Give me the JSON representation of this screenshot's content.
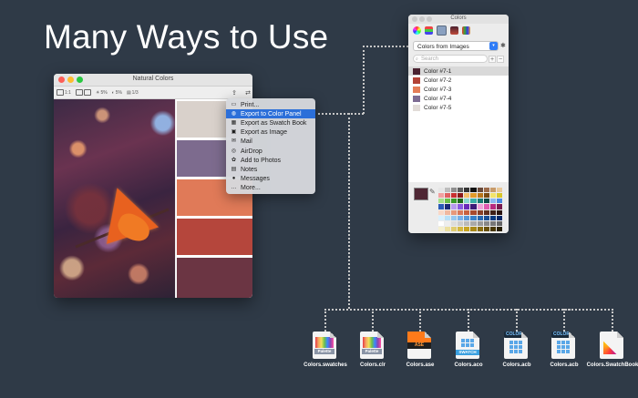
{
  "hero": {
    "title": "Many Ways to Use"
  },
  "window": {
    "title": "Natural Colors",
    "toolbar": [
      "1:1",
      "5%",
      "5%",
      "1/3"
    ],
    "swatch_colors": [
      "#d9d1cb",
      "#7d6b8e",
      "#e07a58",
      "#b5463c",
      "#6b3543"
    ]
  },
  "menu": {
    "items": [
      {
        "label": "Print...",
        "icon": "print-icon"
      },
      {
        "label": "Export to Color Panel",
        "icon": "color-wheel-icon",
        "active": true
      },
      {
        "label": "Export as Swatch Book",
        "icon": "swatch-book-icon"
      },
      {
        "label": "Export as Image",
        "icon": "image-icon"
      },
      {
        "label": "Mail",
        "icon": "mail-icon"
      },
      {
        "label": "AirDrop",
        "icon": "airdrop-icon"
      },
      {
        "label": "Add to Photos",
        "icon": "photos-icon"
      },
      {
        "label": "Notes",
        "icon": "notes-icon"
      },
      {
        "label": "Messages",
        "icon": "messages-icon"
      },
      {
        "label": "More...",
        "icon": "more-icon"
      }
    ]
  },
  "panel": {
    "title": "Colors",
    "select_value": "Colors from Images",
    "search_placeholder": "Search",
    "add_label": "+",
    "remove_label": "−",
    "colors": [
      {
        "name": "Color #7-1",
        "hex": "#4a2230"
      },
      {
        "name": "Color #7-2",
        "hex": "#b34236"
      },
      {
        "name": "Color #7-3",
        "hex": "#e47d58"
      },
      {
        "name": "Color #7-4",
        "hex": "#7e6c93"
      },
      {
        "name": "Color #7-5",
        "hex": "#e2dcd8"
      }
    ],
    "current_color": "#4e2633"
  },
  "files": [
    {
      "label": "Colors.swatches",
      "badge": "Palette",
      "kind": "palette"
    },
    {
      "label": "Colors.clr",
      "badge": "Palette",
      "kind": "palette"
    },
    {
      "label": "Colors.ase",
      "badge": "ASE",
      "kind": "ase"
    },
    {
      "label": "Colors.aco",
      "badge": "SWATCH",
      "kind": "swatch"
    },
    {
      "label": "Colors.acb",
      "badge": "COLOR",
      "kind": "acb"
    },
    {
      "label": "Colors.acb",
      "badge": "COLOR",
      "kind": "acb"
    },
    {
      "label": "Colors.SwatchBook",
      "badge": "",
      "kind": "swatchbook"
    }
  ]
}
